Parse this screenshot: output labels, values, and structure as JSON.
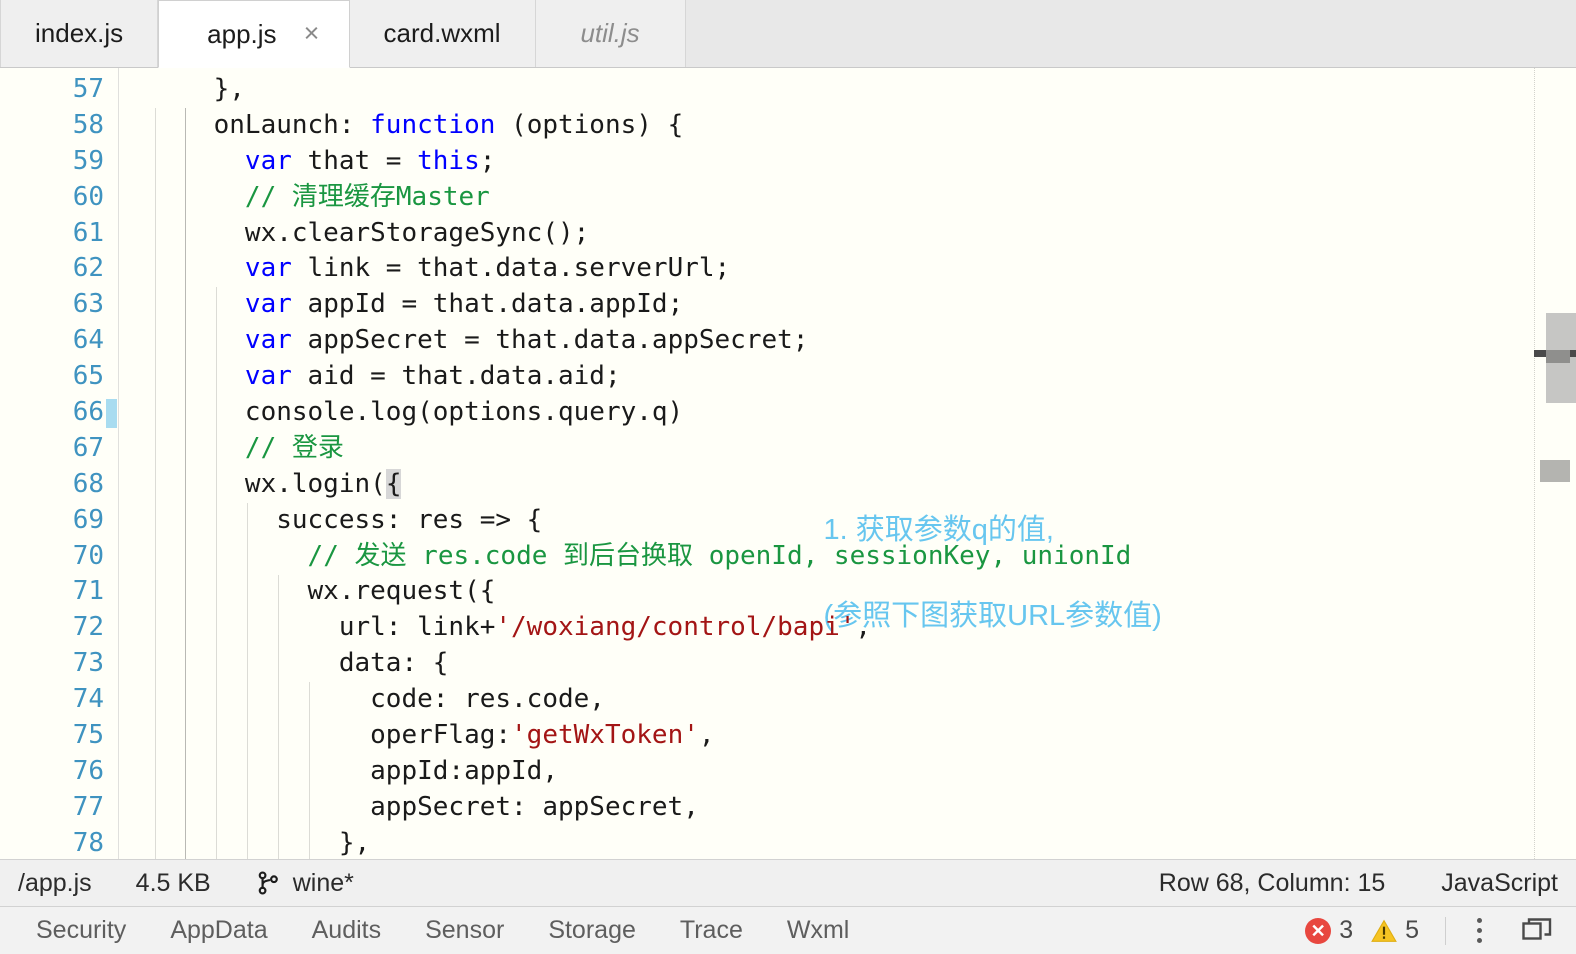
{
  "tabbar": {
    "tabs": [
      {
        "label": "index.js",
        "state": "inactive"
      },
      {
        "label": "app.js",
        "state": "active",
        "close_glyph": "×"
      },
      {
        "label": "card.wxml",
        "state": "inactive"
      },
      {
        "label": "util.js",
        "state": "preview"
      }
    ]
  },
  "editor": {
    "language": "JavaScript",
    "first_line": 57,
    "cursor_line": 66,
    "lines": [
      {
        "n": "57",
        "segments": [
          {
            "t": "    },",
            "c": "plain"
          }
        ]
      },
      {
        "n": "58",
        "segments": [
          {
            "t": "    onLaunch: ",
            "c": "plain"
          },
          {
            "t": "function",
            "c": "kw"
          },
          {
            "t": " (options) {",
            "c": "plain"
          }
        ]
      },
      {
        "n": "59",
        "segments": [
          {
            "t": "      ",
            "c": "plain"
          },
          {
            "t": "var",
            "c": "kw"
          },
          {
            "t": " that = ",
            "c": "plain"
          },
          {
            "t": "this",
            "c": "kw"
          },
          {
            "t": ";",
            "c": "plain"
          }
        ]
      },
      {
        "n": "60",
        "segments": [
          {
            "t": "      ",
            "c": "plain"
          },
          {
            "t": "// 清理缓存Master",
            "c": "cmt"
          }
        ]
      },
      {
        "n": "61",
        "segments": [
          {
            "t": "      wx.clearStorageSync();",
            "c": "plain"
          }
        ]
      },
      {
        "n": "62",
        "segments": [
          {
            "t": "      ",
            "c": "plain"
          },
          {
            "t": "var",
            "c": "kw"
          },
          {
            "t": " link = that.data.serverUrl;",
            "c": "plain"
          }
        ]
      },
      {
        "n": "63",
        "segments": [
          {
            "t": "      ",
            "c": "plain"
          },
          {
            "t": "var",
            "c": "kw"
          },
          {
            "t": " appId = that.data.appId;",
            "c": "plain"
          }
        ]
      },
      {
        "n": "64",
        "segments": [
          {
            "t": "      ",
            "c": "plain"
          },
          {
            "t": "var",
            "c": "kw"
          },
          {
            "t": " appSecret = that.data.appSecret;",
            "c": "plain"
          }
        ]
      },
      {
        "n": "65",
        "segments": [
          {
            "t": "      ",
            "c": "plain"
          },
          {
            "t": "var",
            "c": "kw"
          },
          {
            "t": " aid = that.data.aid;",
            "c": "plain"
          }
        ]
      },
      {
        "n": "66",
        "segments": [
          {
            "t": "      console.log(options.query.q)",
            "c": "plain"
          }
        ]
      },
      {
        "n": "67",
        "segments": [
          {
            "t": "      ",
            "c": "plain"
          },
          {
            "t": "// 登录",
            "c": "cmt"
          }
        ]
      },
      {
        "n": "68",
        "segments": [
          {
            "t": "      wx.login(",
            "c": "plain"
          },
          {
            "t": "{",
            "c": "hl"
          }
        ]
      },
      {
        "n": "69",
        "segments": [
          {
            "t": "        success: res => {",
            "c": "plain"
          }
        ]
      },
      {
        "n": "70",
        "segments": [
          {
            "t": "          ",
            "c": "plain"
          },
          {
            "t": "// 发送 res.code 到后台换取 openId, sessionKey, unionId",
            "c": "cmt"
          }
        ]
      },
      {
        "n": "71",
        "segments": [
          {
            "t": "          wx.request({",
            "c": "plain"
          }
        ]
      },
      {
        "n": "72",
        "segments": [
          {
            "t": "            url: link+",
            "c": "plain"
          },
          {
            "t": "'/woxiang/control/bapi'",
            "c": "str"
          },
          {
            "t": ",",
            "c": "plain"
          }
        ]
      },
      {
        "n": "73",
        "segments": [
          {
            "t": "            data: {",
            "c": "plain"
          }
        ]
      },
      {
        "n": "74",
        "segments": [
          {
            "t": "              code: res.code,",
            "c": "plain"
          }
        ]
      },
      {
        "n": "75",
        "segments": [
          {
            "t": "              operFlag:",
            "c": "plain"
          },
          {
            "t": "'getWxToken'",
            "c": "str"
          },
          {
            "t": ",",
            "c": "plain"
          }
        ]
      },
      {
        "n": "76",
        "segments": [
          {
            "t": "              appId:appId,",
            "c": "plain"
          }
        ]
      },
      {
        "n": "77",
        "segments": [
          {
            "t": "              appSecret: appSecret,",
            "c": "plain"
          }
        ]
      },
      {
        "n": "78",
        "segments": [
          {
            "t": "            },",
            "c": "plain"
          }
        ]
      }
    ],
    "annotation": {
      "line1": "1. 获取参数q的值,",
      "line2": "(参照下图获取URL参数值)",
      "color": "#67c6ef"
    }
  },
  "statusbar": {
    "file_path": "/app.js",
    "file_size": "4.5 KB",
    "branch": "wine*",
    "cursor_position": "Row 68, Column: 15",
    "language": "JavaScript"
  },
  "panel": {
    "tabs": [
      {
        "label": "Security"
      },
      {
        "label": "AppData"
      },
      {
        "label": "Audits"
      },
      {
        "label": "Sensor"
      },
      {
        "label": "Storage"
      },
      {
        "label": "Trace"
      },
      {
        "label": "Wxml"
      }
    ],
    "error_count": "3",
    "warning_count": "5",
    "error_color": "#e8473f",
    "warning_color": "#f6c423"
  }
}
